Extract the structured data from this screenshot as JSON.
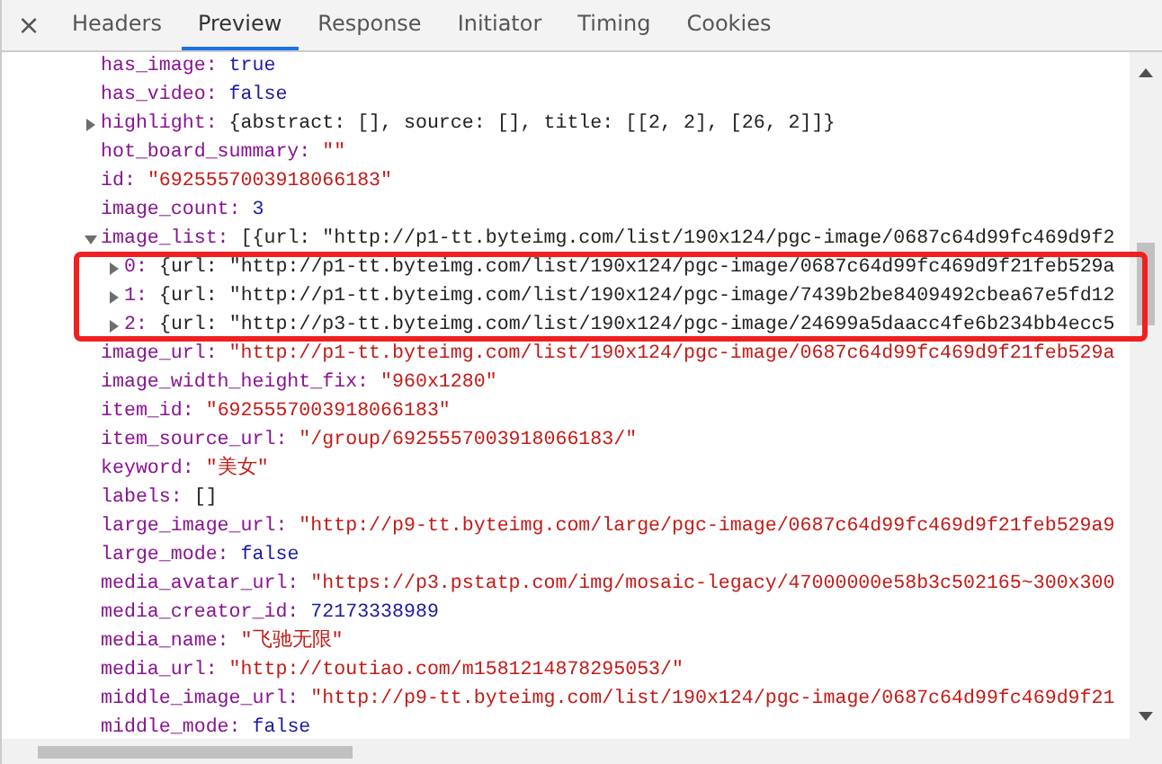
{
  "close_label": "×",
  "tabs": [
    {
      "label": "Headers",
      "selected": false
    },
    {
      "label": "Preview",
      "selected": true
    },
    {
      "label": "Response",
      "selected": false
    },
    {
      "label": "Initiator",
      "selected": false
    },
    {
      "label": "Timing",
      "selected": false
    },
    {
      "label": "Cookies",
      "selected": false
    }
  ],
  "preview": [
    {
      "key": "has_image:",
      "value": "true",
      "kind": "keyword"
    },
    {
      "key": "has_video:",
      "value": "false",
      "kind": "keyword"
    },
    {
      "key": "highlight:",
      "value": "{abstract: [], source: [], title: [[2, 2], [26, 2]]}",
      "kind": "object",
      "expanded": false
    },
    {
      "key": "hot_board_summary:",
      "value": "\"\"",
      "kind": "string"
    },
    {
      "key": "id:",
      "value": "\"6925557003918066183\"",
      "kind": "string"
    },
    {
      "key": "image_count:",
      "value": "3",
      "kind": "keyword"
    },
    {
      "key": "image_list:",
      "value": "[{url: \"http://p1-tt.byteimg.com/list/190x124/pgc-image/0687c64d99fc469d9f2",
      "kind": "object",
      "expanded": true,
      "highlighted": true,
      "children": [
        {
          "key": "0:",
          "value": "{url: \"http://p1-tt.byteimg.com/list/190x124/pgc-image/0687c64d99fc469d9f21feb529a",
          "kind": "object",
          "expanded": false
        },
        {
          "key": "1:",
          "value": "{url: \"http://p1-tt.byteimg.com/list/190x124/pgc-image/7439b2be8409492cbea67e5fd12",
          "kind": "object",
          "expanded": false
        },
        {
          "key": "2:",
          "value": "{url: \"http://p3-tt.byteimg.com/list/190x124/pgc-image/24699a5daacc4fe6b234bb4ecc5",
          "kind": "object",
          "expanded": false
        }
      ]
    },
    {
      "key": "image_url:",
      "value": "\"http://p1-tt.byteimg.com/list/190x124/pgc-image/0687c64d99fc469d9f21feb529a",
      "kind": "string"
    },
    {
      "key": "image_width_height_fix:",
      "value": "\"960x1280\"",
      "kind": "string"
    },
    {
      "key": "item_id:",
      "value": "\"6925557003918066183\"",
      "kind": "string"
    },
    {
      "key": "item_source_url:",
      "value": "\"/group/6925557003918066183/\"",
      "kind": "string"
    },
    {
      "key": "keyword:",
      "value": "\"美女\"",
      "kind": "string"
    },
    {
      "key": "labels:",
      "value": "[]",
      "kind": "object"
    },
    {
      "key": "large_image_url:",
      "value": "\"http://p9-tt.byteimg.com/large/pgc-image/0687c64d99fc469d9f21feb529a9",
      "kind": "string"
    },
    {
      "key": "large_mode:",
      "value": "false",
      "kind": "keyword"
    },
    {
      "key": "media_avatar_url:",
      "value": "\"https://p3.pstatp.com/img/mosaic-legacy/47000000e58b3c502165~300x300",
      "kind": "string"
    },
    {
      "key": "media_creator_id:",
      "value": "72173338989",
      "kind": "keyword"
    },
    {
      "key": "media_name:",
      "value": "\"飞驰无限\"",
      "kind": "string"
    },
    {
      "key": "media_url:",
      "value": "\"http://toutiao.com/m1581214878295053/\"",
      "kind": "string"
    },
    {
      "key": "middle_image_url:",
      "value": "\"http://p9-tt.byteimg.com/list/190x124/pgc-image/0687c64d99fc469d9f21",
      "kind": "string"
    },
    {
      "key": "middle_mode:",
      "value": "false",
      "kind": "keyword"
    }
  ]
}
